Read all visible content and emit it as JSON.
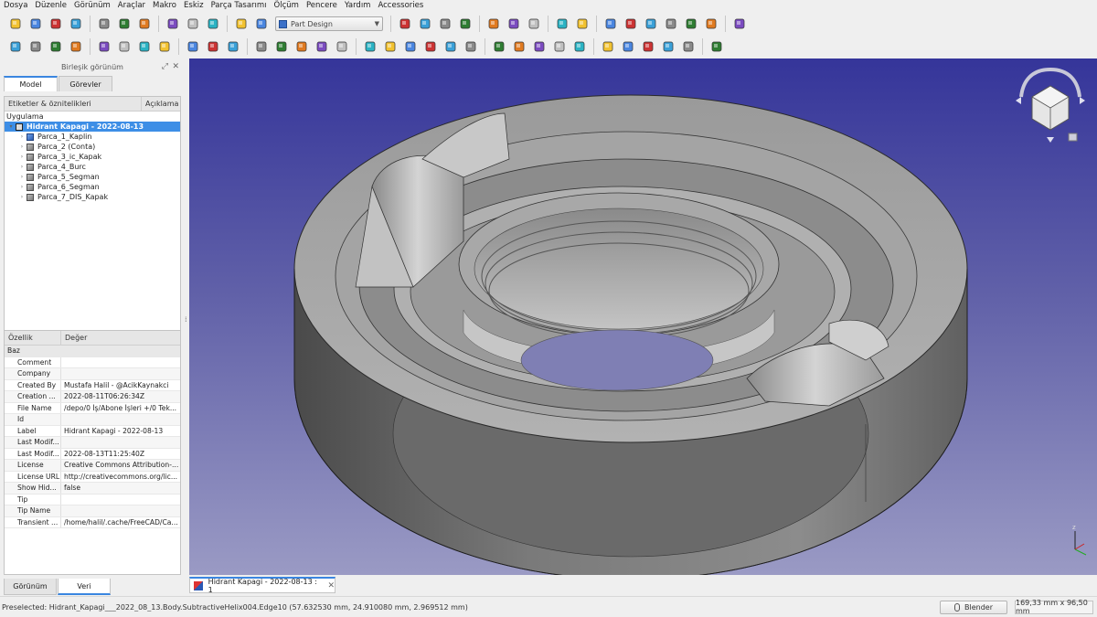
{
  "menubar": [
    "Dosya",
    "Düzenle",
    "Görünüm",
    "Araçlar",
    "Makro",
    "Eskiz",
    "Parça Tasarımı",
    "Ölçüm",
    "Pencere",
    "Yardım",
    "Accessories"
  ],
  "toolbar": {
    "workbench_label": "Part Design",
    "row1_icons": [
      "new-file-icon",
      "open-file-icon",
      "save-icon",
      "print-icon",
      "cut-icon",
      "copy-icon",
      "paste-icon",
      "undo-icon",
      "redo-icon",
      "macro-icon",
      "refresh-icon",
      "whats-this-icon",
      "view-fit-all-icon",
      "view-fit-selection-icon",
      "draw-style-icon",
      "bounding-box-icon",
      "back-icon",
      "forward-icon",
      "sync-view-icon",
      "zoom-icon",
      "isometric-icon",
      "front-view-icon",
      "top-view-icon",
      "right-view-icon",
      "rear-view-icon",
      "bottom-view-icon",
      "left-view-icon",
      "measure-icon"
    ],
    "row2_icons": [
      "create-body-icon",
      "create-part-icon",
      "export-icon",
      "shape-binder-icon",
      "datum-point-icon",
      "datum-line-icon",
      "datum-plane-icon",
      "local-cs-icon",
      "sketch-icon",
      "validate-sketch-icon",
      "map-sketch-icon",
      "pad-icon",
      "revolution-icon",
      "loft-icon",
      "pipe-icon",
      "helix-icon",
      "pocket-icon",
      "hole-icon",
      "groove-icon",
      "subtractive-loft-icon",
      "subtractive-pipe-icon",
      "subtractive-helix-icon",
      "fillet-icon",
      "chamfer-icon",
      "draft-icon",
      "thickness-icon",
      "boolean-icon",
      "mirrored-icon",
      "linear-pattern-icon",
      "polar-pattern-icon",
      "scaled-icon",
      "multitransform-icon",
      "sprocket-icon"
    ]
  },
  "panel": {
    "title": "Birleşik görünüm",
    "tabs": [
      "Model",
      "Görevler"
    ],
    "tree_headers": [
      "Etiketler & öznitelikleri",
      "Açıklama"
    ],
    "tree_root_label": "Uygulama",
    "tree_items": [
      {
        "label": "Hidrant Kapagi - 2022-08-13",
        "selected": true,
        "icon": "document-icon"
      },
      {
        "label": "Parca_1_Kaplin",
        "selected": false,
        "icon": "part-blue-icon"
      },
      {
        "label": "Parca_2 (Conta)",
        "selected": false,
        "icon": "part-icon"
      },
      {
        "label": "Parca_3_ic_Kapak",
        "selected": false,
        "icon": "part-icon"
      },
      {
        "label": "Parca_4_Burc",
        "selected": false,
        "icon": "part-icon"
      },
      {
        "label": "Parca_5_Segman",
        "selected": false,
        "icon": "part-icon"
      },
      {
        "label": "Parca_6_Segman",
        "selected": false,
        "icon": "part-icon"
      },
      {
        "label": "Parca_7_DIS_Kapak",
        "selected": false,
        "icon": "part-icon"
      }
    ],
    "splitter_mark": "-----",
    "props_headers": [
      "Özellik",
      "Değer"
    ],
    "props_group": "Baz",
    "properties": [
      {
        "key": "Comment",
        "value": ""
      },
      {
        "key": "Company",
        "value": ""
      },
      {
        "key": "Created By",
        "value": "Mustafa Halil - @AcikKaynakci"
      },
      {
        "key": "Creation ...",
        "value": "2022-08-11T06:26:34Z"
      },
      {
        "key": "File Name",
        "value": "/depo/0 İş/Abone İşleri +/0 Tek..."
      },
      {
        "key": "Id",
        "value": ""
      },
      {
        "key": "Label",
        "value": "Hidrant Kapagi - 2022-08-13"
      },
      {
        "key": "Last Modif...",
        "value": ""
      },
      {
        "key": "Last Modif...",
        "value": "2022-08-13T11:25:40Z"
      },
      {
        "key": "License",
        "value": "Creative Commons Attribution-..."
      },
      {
        "key": "License URL",
        "value": "http://creativecommons.org/lic..."
      },
      {
        "key": "Show Hid...",
        "value": "false"
      },
      {
        "key": "Tip",
        "value": ""
      },
      {
        "key": "Tip Name",
        "value": ""
      },
      {
        "key": "Transient ...",
        "value": "/home/halil/.cache/FreeCAD/Ca..."
      }
    ],
    "bottom_tabs": [
      "Görünüm",
      "Veri"
    ]
  },
  "document_tab": "Hidrant Kapagi - 2022-08-13 : 1",
  "status": {
    "preselected": "Preselected: Hidrant_Kapagi___2022_08_13.Body.SubtractiveHelix004.Edge10 (57.632530 mm, 24.910080 mm, 2.969512 mm)",
    "nav_style": "Blender",
    "dimensions": "169,33 mm x 96,50 mm"
  },
  "colors": {
    "selection": "#3d8ee6",
    "viewport_top": "#35359a",
    "viewport_bottom": "#9a9ac4",
    "accent": "#3a86e0"
  }
}
